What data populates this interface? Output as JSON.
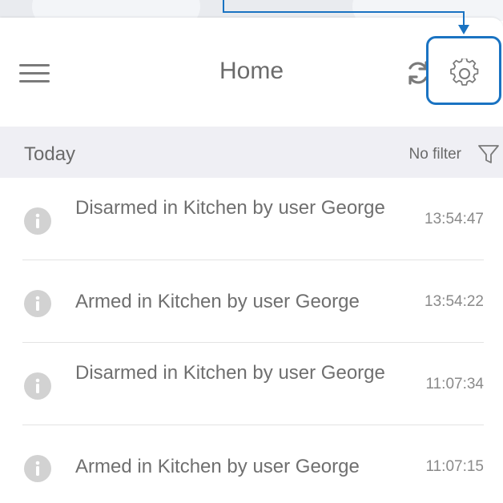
{
  "header": {
    "title": "Home",
    "menu_icon": "hamburger-menu-icon",
    "refresh_icon": "refresh-icon",
    "settings_icon": "gear-icon"
  },
  "section": {
    "title": "Today",
    "filter_label": "No filter",
    "filter_icon": "funnel-icon"
  },
  "events": [
    {
      "message": "Disarmed in Kitchen by user George",
      "time": "13:54:47",
      "icon": "info-icon"
    },
    {
      "message": "Armed in Kitchen by user George",
      "time": "13:54:22",
      "icon": "info-icon"
    },
    {
      "message": "Disarmed in Kitchen by user George",
      "time": "11:07:34",
      "icon": "info-icon"
    },
    {
      "message": "Armed in Kitchen by user George",
      "time": "11:07:15",
      "icon": "info-icon"
    }
  ],
  "colors": {
    "callout": "#1a73c2",
    "section_bg": "#efeff4",
    "icon_gray": "#d2d2d2",
    "text_gray": "#6f6f6f"
  }
}
